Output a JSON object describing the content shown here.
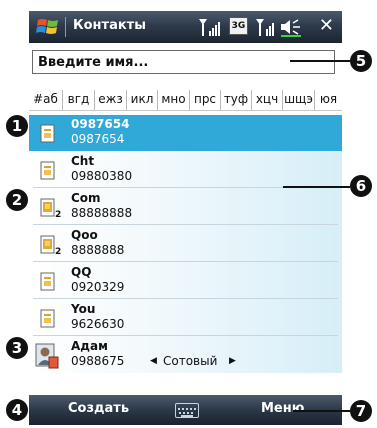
{
  "title_bar": {
    "app_title": "Контакты",
    "network_badge": "3G",
    "icons": [
      "windows-start-icon",
      "signal-icon",
      "3g-icon",
      "signal-icon",
      "speaker-icon",
      "close-icon"
    ],
    "close_label": "✕"
  },
  "search": {
    "placeholder": "Введите имя..."
  },
  "alpha_tabs": [
    "#аб",
    "вгд",
    "ежз",
    "икл",
    "мно",
    "прс",
    "туф",
    "хцч",
    "шщэ",
    "юя"
  ],
  "contacts": [
    {
      "name": "0987654",
      "phone": "0987654",
      "selected": true,
      "icon": "contact-card-icon"
    },
    {
      "name": "Cht",
      "phone": "09880380",
      "icon": "contact-card-icon"
    },
    {
      "name": "Com",
      "phone": "88888888",
      "icon": "sim-contact-icon",
      "badge": "2"
    },
    {
      "name": "Qoo",
      "phone": "8888888",
      "icon": "sim-contact-icon",
      "badge": "2"
    },
    {
      "name": "QQ",
      "phone": "0920329",
      "icon": "contact-card-icon"
    },
    {
      "name": "You",
      "phone": "9626630",
      "icon": "contact-card-icon"
    },
    {
      "name": "Адам",
      "phone": "0988675",
      "phone_type": "Сотовый",
      "icon": "contact-photo-icon"
    }
  ],
  "softkeys": {
    "left": "Создать",
    "right": "Меню",
    "center_icon": "keyboard-icon"
  },
  "callouts": [
    "1",
    "2",
    "3",
    "4",
    "5",
    "6",
    "7"
  ],
  "colors": {
    "selection": "#30a8d8",
    "bar_dark": "#1b2430",
    "callout": "#111111"
  }
}
